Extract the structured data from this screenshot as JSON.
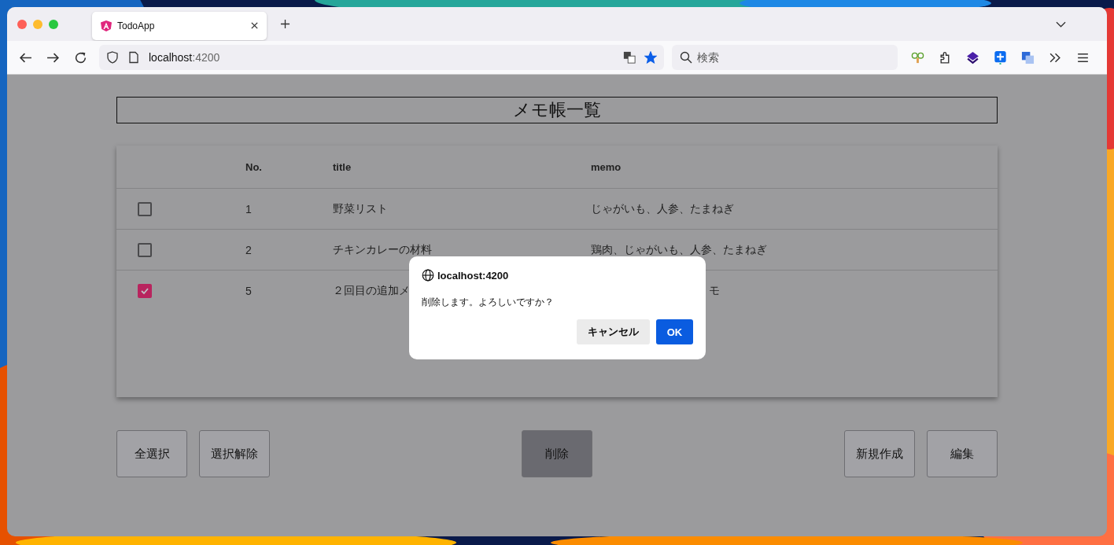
{
  "browser": {
    "tab": {
      "title": "TodoApp",
      "selected": true
    },
    "url_host": "localhost",
    "url_port": ":4200",
    "bookmarked": true,
    "search": {
      "placeholder": "検索"
    }
  },
  "page": {
    "heading": "メモ帳一覧",
    "table": {
      "columns": [
        "No.",
        "title",
        "memo"
      ],
      "rows": [
        {
          "checked": false,
          "no": "1",
          "title": "野菜リスト",
          "memo": "じゃがいも、人参、たまねぎ"
        },
        {
          "checked": false,
          "no": "2",
          "title": "チキンカレーの材料",
          "memo": "鶏肉、じゃがいも、人参、たまねぎ"
        },
        {
          "checked": true,
          "no": "5",
          "title": "２回目の追加メ",
          "memo": "モ"
        }
      ]
    },
    "buttons_left": [
      {
        "label": "全選択",
        "pressed": false
      },
      {
        "label": "選択解除",
        "pressed": false
      }
    ],
    "button_center": {
      "label": "削除",
      "pressed": true
    },
    "buttons_right": [
      {
        "label": "新規作成",
        "pressed": false
      },
      {
        "label": "編集",
        "pressed": false
      }
    ]
  },
  "dialog": {
    "origin": "localhost:4200",
    "message": "削除します。よろしいですか？",
    "cancel": "キャンセル",
    "ok": "OK"
  }
}
